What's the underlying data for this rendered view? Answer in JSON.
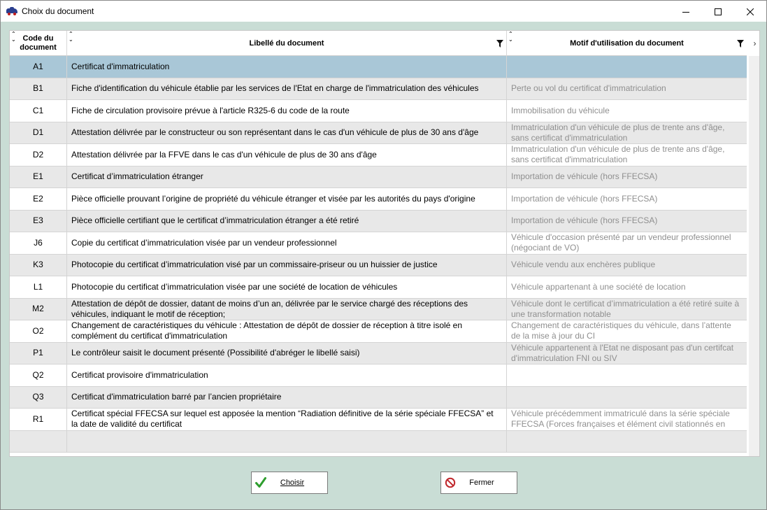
{
  "window": {
    "title": "Choix du document"
  },
  "table": {
    "headers": {
      "code": "Code du document",
      "libelle": "Libellé du document",
      "motif": "Motif d'utilisation du document"
    },
    "rows": [
      {
        "code": "A1",
        "libelle": "Certificat d'immatriculation",
        "motif": ""
      },
      {
        "code": "B1",
        "libelle": "Fiche d'identification du véhicule établie par les services de l'Etat en charge de l'immatriculation des véhicules",
        "motif": "Perte ou vol du certificat d'immatriculation"
      },
      {
        "code": "C1",
        "libelle": "Fiche de circulation provisoire prévue à l'article R325-6 du code de la route",
        "motif": "Immobilisation du véhicule"
      },
      {
        "code": "D1",
        "libelle": "Attestation délivrée par le constructeur ou son représentant dans le cas d'un véhicule de plus de 30 ans d'âge",
        "motif": "Immatriculation d'un véhicule de plus de trente ans d'âge, sans certificat d'immatriculation"
      },
      {
        "code": "D2",
        "libelle": "Attestation délivrée par la FFVE dans le cas d'un véhicule de plus de 30 ans d'âge",
        "motif": "Immatriculation d'un véhicule de plus de trente ans d'âge, sans certificat d'immatriculation"
      },
      {
        "code": "E1",
        "libelle": "Certificat d’immatriculation étranger",
        "motif": "Importation de véhicule (hors FFECSA)"
      },
      {
        "code": "E2",
        "libelle": "Pièce officielle prouvant l’origine de propriété du véhicule étranger et visée par les autorités du pays d'origine",
        "motif": "Importation de véhicule (hors FFECSA)"
      },
      {
        "code": "E3",
        "libelle": "Pièce officielle certifiant que le certificat d’immatriculation étranger a été retiré",
        "motif": "Importation de véhicule (hors FFECSA)"
      },
      {
        "code": "J6",
        "libelle": "Copie du certificat d’immatriculation visée par un vendeur professionnel",
        "motif": "Véhicule d'occasion présenté par un vendeur professionnel (négociant de VO)"
      },
      {
        "code": "K3",
        "libelle": "Photocopie du certificat d’immatriculation visé par un commissaire-priseur ou un huissier de justice",
        "motif": "Véhicule vendu aux enchères publique"
      },
      {
        "code": "L1",
        "libelle": "Photocopie du certificat d’immatriculation visée par une société de location de véhicules",
        "motif": "Véhicule appartenant à une société de location"
      },
      {
        "code": "M2",
        "libelle": "Attestation de dépôt de dossier, datant de moins d’un an, délivrée par le service chargé des réceptions des véhicules, indiquant le motif de réception;",
        "motif": "Véhicule dont le certificat d’immatriculation a été retiré suite à une transformation notable"
      },
      {
        "code": "O2",
        "libelle": "Changement de caractéristiques du véhicule : Attestation de dépôt de dossier de réception à titre isolé en complément du certificat d'immatriculation",
        "motif": "Changement de caractéristiques du véhicule, dans l’attente de la mise à jour du CI"
      },
      {
        "code": "P1",
        "libelle": "Le contrôleur saisit le document présenté (Possibilité d'abréger le libellé saisi)",
        "motif": "Véhicule appartenent à l'Etat ne disposant pas d'un certifcat d'immatriculation FNI ou SIV"
      },
      {
        "code": "Q2",
        "libelle": "Certificat provisoire d'immatriculation",
        "motif": ""
      },
      {
        "code": "Q3",
        "libelle": "Certificat d'immatriculation barré par l’ancien propriétaire",
        "motif": ""
      },
      {
        "code": "R1",
        "libelle": "Certificat spécial FFECSA sur lequel est apposée la mention “Radiation définitive de la série spéciale FFECSA” et la date de validité du certificat",
        "motif": "Véhicule précédemment immatriculé dans la série spéciale FFECSA (Forces françaises et élément civil stationnés en"
      },
      {
        "code": "",
        "libelle": "",
        "motif": ""
      }
    ],
    "selected_row": 0
  },
  "buttons": {
    "choose": "Choisir",
    "close": "Fermer"
  },
  "colors": {
    "background": "#c9ddd5",
    "selected_row": "#a9c7d7",
    "alt_row": "#e8e8e8",
    "motif_text": "#8f8f8f",
    "check_icon": "#2e9e2e",
    "no_icon": "#c0282d"
  },
  "icons": {
    "app": "car-icon",
    "choose": "check-icon",
    "close": "no-entry-icon",
    "filter": "filter-icon"
  }
}
